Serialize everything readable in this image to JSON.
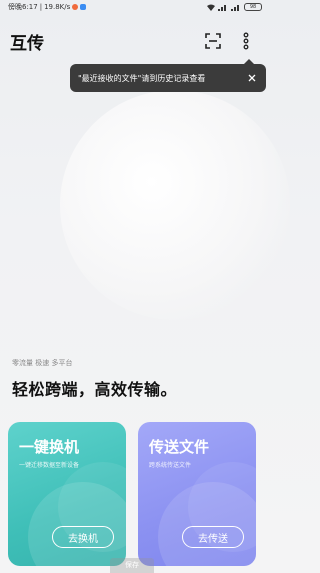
{
  "status_bar": {
    "time_text": "傍晚6:17",
    "speed_text": "19.8K/s",
    "battery_text": "98"
  },
  "header": {
    "title": "互传"
  },
  "tooltip": {
    "text": "\"最近接收的文件\"请到历史记录查看"
  },
  "hero": {
    "tagline_small": "零流量 极速 多平台",
    "tagline_big": "轻松跨端，高效传输。"
  },
  "cards": [
    {
      "title": "一键换机",
      "subtitle": "一键迁移数据至新设备",
      "button": "去换机",
      "color": "#45c4bd"
    },
    {
      "title": "传送文件",
      "subtitle": "跨系统传送文件",
      "button": "去传送",
      "color": "#8a90f1"
    }
  ],
  "bottom": {
    "hint": "保存"
  },
  "icons": [
    "scan-icon",
    "more-icon",
    "close-icon",
    "wifi-icon",
    "signal-icon",
    "battery-icon"
  ]
}
